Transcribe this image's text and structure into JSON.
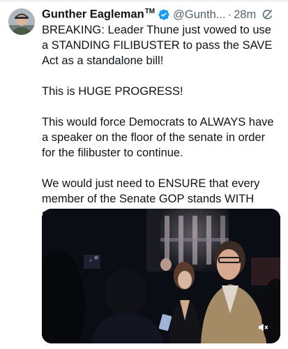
{
  "tweet": {
    "author_name": "Gunther Eagleman",
    "author_badge": "TM",
    "handle": "@Gunth...",
    "separator": "·",
    "time": "28m",
    "paragraphs": [
      "BREAKING: Leader Thune just vowed to use a STANDING FILIBUSTER to pass the SAVE Act as a standalone bill!",
      "This is HUGE PROGRESS!",
      "This would force Democrats to ALWAYS have a speaker on the floor of the senate in order for the filibuster to continue.",
      "We would just need to ENSURE that every member of the Senate GOP stands WITH secure elections!"
    ]
  },
  "icons": {
    "verified": "verified-badge-icon",
    "grok": "grok-icon",
    "mute": "speaker-muted-icon"
  },
  "colors": {
    "verified_blue": "#1d9bf0",
    "text": "#0f1419",
    "secondary_text": "#536471"
  }
}
